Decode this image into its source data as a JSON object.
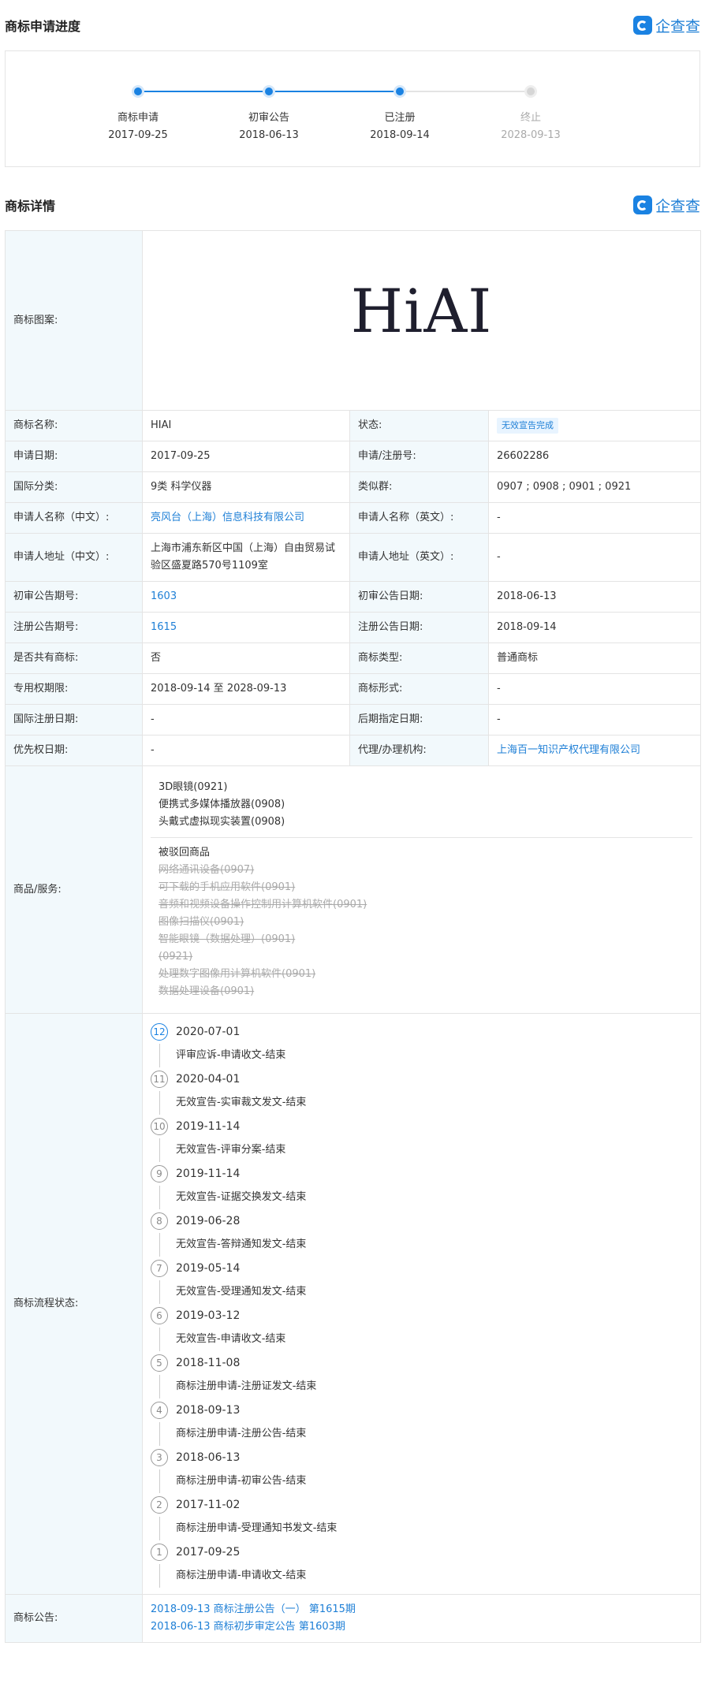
{
  "progress": {
    "title": "商标申请进度",
    "brand": "企查查",
    "steps": [
      {
        "name": "商标申请",
        "date": "2017-09-25"
      },
      {
        "name": "初审公告",
        "date": "2018-06-13"
      },
      {
        "name": "已注册",
        "date": "2018-09-14"
      },
      {
        "name": "终止",
        "date": "2028-09-13"
      }
    ]
  },
  "detail": {
    "title": "商标详情",
    "brand": "企查查",
    "logo_label": "商标图案:",
    "logo_text": "HiAI",
    "rows": {
      "name_label": "商标名称:",
      "name": "HIAI",
      "status_label": "状态:",
      "status": "无效宣告完成",
      "apply_date_label": "申请日期:",
      "apply_date": "2017-09-25",
      "reg_no_label": "申请/注册号:",
      "reg_no": "26602286",
      "intl_class_label": "国际分类:",
      "intl_class": "9类 科学仪器",
      "similar_group_label": "类似群:",
      "similar_group": "0907 ; 0908 ; 0901 ; 0921",
      "applicant_cn_label": "申请人名称（中文）:",
      "applicant_cn": "亮风台（上海）信息科技有限公司",
      "applicant_en_label": "申请人名称（英文）:",
      "applicant_en": "-",
      "address_cn_label": "申请人地址（中文）:",
      "address_cn": "上海市浦东新区中国（上海）自由贸易试验区盛夏路570号1109室",
      "address_en_label": "申请人地址（英文）:",
      "address_en": "-",
      "prelim_no_label": "初审公告期号:",
      "prelim_no": "1603",
      "prelim_date_label": "初审公告日期:",
      "prelim_date": "2018-06-13",
      "reg_notice_no_label": "注册公告期号:",
      "reg_notice_no": "1615",
      "reg_notice_date_label": "注册公告日期:",
      "reg_notice_date": "2018-09-14",
      "shared_label": "是否共有商标:",
      "shared": "否",
      "type_label": "商标类型:",
      "type": "普通商标",
      "term_label": "专用权期限:",
      "term": "2018-09-14 至 2028-09-13",
      "form_label": "商标形式:",
      "form": "-",
      "intl_reg_label": "国际注册日期:",
      "intl_reg": "-",
      "later_label": "后期指定日期:",
      "later": "-",
      "priority_label": "优先权日期:",
      "priority": "-",
      "agent_label": "代理/办理机构:",
      "agent": "上海百一知识产权代理有限公司"
    },
    "goods_label": "商品/服务:",
    "goods_active": [
      "3D眼镜(0921)",
      "便携式多媒体播放器(0908)",
      "头戴式虚拟现实装置(0908)"
    ],
    "goods_rejected_title": "被驳回商品",
    "goods_rejected": [
      "网络通讯设备(0907)",
      "可下载的手机应用软件(0901)",
      "音频和视频设备操作控制用计算机软件(0901)",
      "图像扫描仪(0901)",
      "智能眼镜（数据处理）(0901)",
      "(0921)",
      "处理数字图像用计算机软件(0901)",
      "数据处理设备(0901)"
    ],
    "flow_label": "商标流程状态:",
    "flow": [
      {
        "num": "12",
        "date": "2020-07-01",
        "desc": "评审应诉-申请收文-结束"
      },
      {
        "num": "11",
        "date": "2020-04-01",
        "desc": "无效宣告-实审裁文发文-结束"
      },
      {
        "num": "10",
        "date": "2019-11-14",
        "desc": "无效宣告-评审分案-结束"
      },
      {
        "num": "9",
        "date": "2019-11-14",
        "desc": "无效宣告-证据交换发文-结束"
      },
      {
        "num": "8",
        "date": "2019-06-28",
        "desc": "无效宣告-答辩通知发文-结束"
      },
      {
        "num": "7",
        "date": "2019-05-14",
        "desc": "无效宣告-受理通知发文-结束"
      },
      {
        "num": "6",
        "date": "2019-03-12",
        "desc": "无效宣告-申请收文-结束"
      },
      {
        "num": "5",
        "date": "2018-11-08",
        "desc": "商标注册申请-注册证发文-结束"
      },
      {
        "num": "4",
        "date": "2018-09-13",
        "desc": "商标注册申请-注册公告-结束"
      },
      {
        "num": "3",
        "date": "2018-06-13",
        "desc": "商标注册申请-初审公告-结束"
      },
      {
        "num": "2",
        "date": "2017-11-02",
        "desc": "商标注册申请-受理通知书发文-结束"
      },
      {
        "num": "1",
        "date": "2017-09-25",
        "desc": "商标注册申请-申请收文-结束"
      }
    ],
    "notice_label": "商标公告:",
    "notices": [
      "2018-09-13 商标注册公告（一） 第1615期",
      "2018-06-13 商标初步审定公告 第1603期"
    ]
  }
}
